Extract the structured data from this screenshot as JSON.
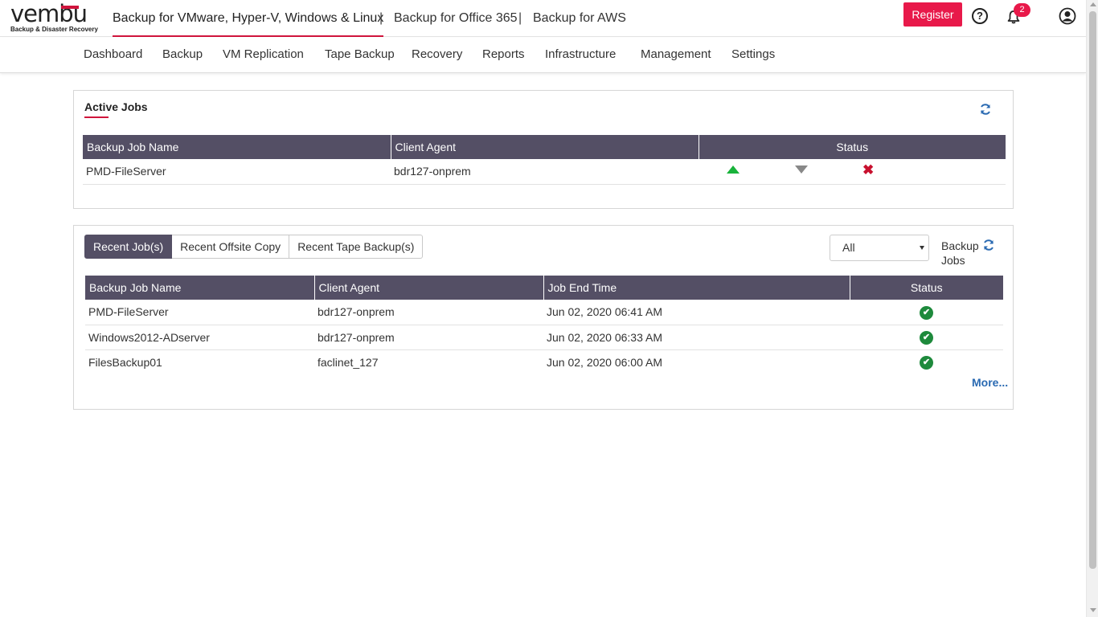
{
  "brand": {
    "name": "vembu",
    "tagline": "Backup & Disaster Recovery"
  },
  "products": [
    {
      "label": "Backup for VMware, Hyper-V, Windows & Linux",
      "active": true
    },
    {
      "label": "Backup for Office 365",
      "active": false
    },
    {
      "label": "Backup for AWS",
      "active": false
    }
  ],
  "separator": "|",
  "header": {
    "register_label": "Register",
    "help_glyph": "?",
    "notification_count": "2"
  },
  "nav": [
    "Dashboard",
    "Backup",
    "VM Replication",
    "Tape Backup",
    "Recovery",
    "Reports",
    "Infrastructure",
    "Management",
    "Settings"
  ],
  "active_jobs": {
    "title": "Active Jobs",
    "columns": [
      "Backup Job Name",
      "Client Agent",
      "Status"
    ],
    "rows": [
      {
        "name": "PMD-FileServer",
        "agent": "bdr127-onprem",
        "status_icons": [
          "resume-icon",
          "pause-icon",
          "cancel-icon"
        ],
        "cancel_glyph": "✖"
      }
    ]
  },
  "recent": {
    "tabs": [
      {
        "label": "Recent Job(s)",
        "active": true
      },
      {
        "label": "Recent Offsite Copy",
        "active": false
      },
      {
        "label": "Recent Tape Backup(s)",
        "active": false
      }
    ],
    "filter": {
      "selected": "All"
    },
    "filter_label": "Backup Jobs",
    "columns": [
      "Backup Job Name",
      "Client Agent",
      "Job End Time",
      "Status"
    ],
    "rows": [
      {
        "name": "PMD-FileServer",
        "agent": "bdr127-onprem",
        "end_time": "Jun 02, 2020 06:41 AM",
        "status": "success"
      },
      {
        "name": "Windows2012-ADserver",
        "agent": "bdr127-onprem",
        "end_time": "Jun 02, 2020 06:33 AM",
        "status": "success"
      },
      {
        "name": "FilesBackup01",
        "agent": "faclinet_127",
        "end_time": "Jun 02, 2020 06:00 AM",
        "status": "success"
      }
    ],
    "check_glyph": "✔",
    "more_label": "More..."
  },
  "colors": {
    "accent": "#e8194a",
    "table_header": "#544f65",
    "success": "#1e8a3c",
    "link": "#2a6ab2"
  }
}
